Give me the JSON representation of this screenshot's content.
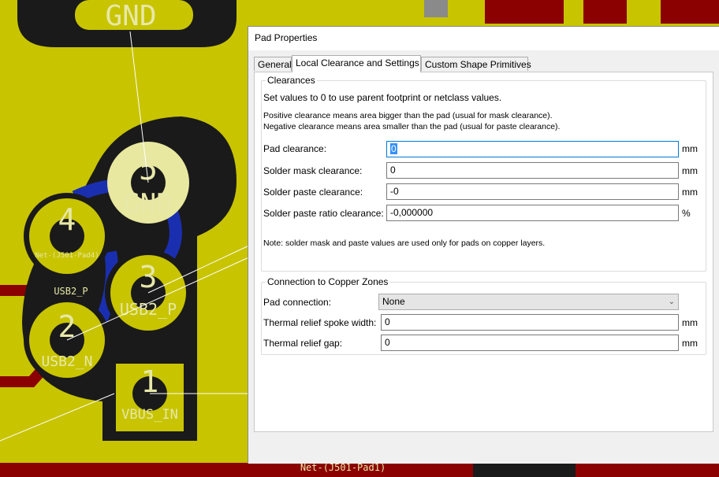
{
  "pcb": {
    "pad_numbers": [
      "5",
      "4",
      "3",
      "2",
      "1"
    ],
    "net_labels": {
      "gnd_top": "GND",
      "gnd_pad": "GND",
      "pad4": "Net-(J501-Pad4)",
      "usb2p_track": "USB2_P",
      "usb2p_pad": "USB2_P",
      "usb2n_pad": "USB2_N",
      "vbus_pad": "VBUS_IN",
      "bottom_track": "Net-(J501-Pad1)"
    },
    "colors": {
      "board": "#c8c400",
      "copper_front": "#8b0000",
      "copper_back": "#1a2fb0",
      "pad_ring": "#e8e8a0",
      "zone": "#1a1a1a"
    }
  },
  "dialog": {
    "title": "Pad Properties",
    "tabs": [
      {
        "label": "General"
      },
      {
        "label": "Local Clearance and Settings"
      },
      {
        "label": "Custom Shape Primitives"
      }
    ],
    "clearances": {
      "legend": "Clearances",
      "hint": "Set values to 0 to use parent footprint or netclass values.",
      "note_positive": "Positive clearance means area bigger than the pad (usual for mask clearance).",
      "note_negative": "Negative clearance means area smaller than the pad (usual for paste clearance).",
      "fields": [
        {
          "label": "Pad clearance:",
          "value": "0",
          "unit": "mm"
        },
        {
          "label": "Solder mask clearance:",
          "value": "0",
          "unit": "mm"
        },
        {
          "label": "Solder paste clearance:",
          "value": "-0",
          "unit": "mm"
        },
        {
          "label": "Solder paste ratio clearance:",
          "value": "-0,000000",
          "unit": "%"
        }
      ],
      "footer_note": "Note: solder mask and paste values are used only for pads on copper layers."
    },
    "zones": {
      "legend": "Connection to Copper Zones",
      "pad_connection_label": "Pad connection:",
      "pad_connection_value": "None",
      "spoke_label": "Thermal relief spoke width:",
      "spoke_value": "0",
      "spoke_unit": "mm",
      "gap_label": "Thermal relief gap:",
      "gap_value": "0",
      "gap_unit": "mm"
    }
  }
}
